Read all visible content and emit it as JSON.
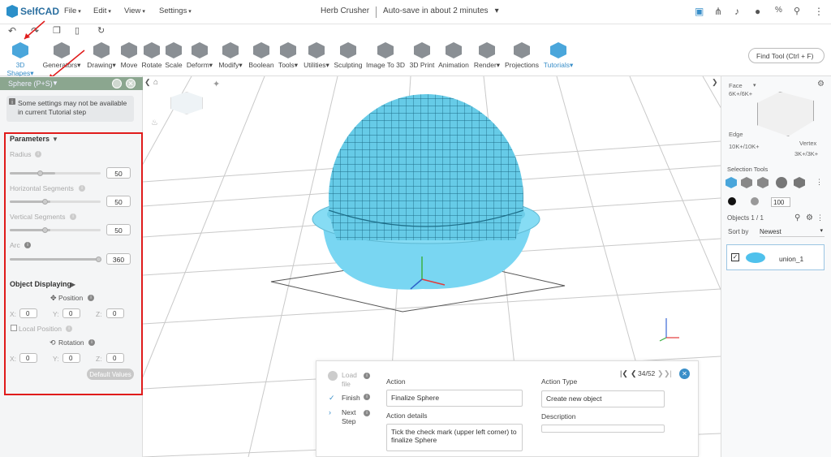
{
  "app": {
    "logo_text": "SelfCAD",
    "doc_name": "Herb Crusher",
    "autosave": "Auto-save in about 2 minutes",
    "autosave_caret": "▾"
  },
  "menus": [
    "File",
    "Edit",
    "View",
    "Settings"
  ],
  "top_icons": [
    "save-icon",
    "share-icon",
    "bell-icon",
    "help-icon",
    "percent-icon",
    "account-icon"
  ],
  "quick": [
    "undo-icon",
    "redo-icon",
    "copy-icon",
    "delete-icon",
    "refresh-icon"
  ],
  "tools": [
    {
      "label": "3D Shapes▾",
      "active": true
    },
    {
      "label": "Generators▾"
    },
    {
      "label": "Drawing▾"
    },
    {
      "label": "Move"
    },
    {
      "label": "Rotate"
    },
    {
      "label": "Scale"
    },
    {
      "label": "Deform▾"
    },
    {
      "label": "Modify▾"
    },
    {
      "label": "Boolean"
    },
    {
      "label": "Tools▾"
    },
    {
      "label": "Utilities▾"
    },
    {
      "label": "Sculpting"
    },
    {
      "label": "Image To 3D"
    },
    {
      "label": "3D Print"
    },
    {
      "label": "Animation"
    },
    {
      "label": "Render▾"
    },
    {
      "label": "Projections"
    },
    {
      "label": "Tutorials▾",
      "active": true
    }
  ],
  "find_tool": "Find Tool (Ctrl + F)",
  "panel": {
    "title": "Sphere (P+S)",
    "notice": "Some settings may not be available in current Tutorial step",
    "parameters": "Parameters",
    "radius": {
      "label": "Radius",
      "value": "50",
      "level": 0.5
    },
    "hseg": {
      "label": "Horizontal Segments",
      "value": "50",
      "level": 0.45
    },
    "vseg": {
      "label": "Vertical Segments",
      "value": "50",
      "level": 0.45
    },
    "arc": {
      "label": "Arc",
      "value": "360",
      "level": 1.0
    },
    "object_displaying": "Object Displaying",
    "position": "Position",
    "x_label": "X:",
    "y_label": "Y:",
    "z_label": "Z:",
    "pos": {
      "x": "0",
      "y": "0",
      "z": "0"
    },
    "local_position": "Local Position",
    "rotation": "Rotation",
    "rot": {
      "x": "0",
      "y": "0",
      "z": "0"
    },
    "default_values": "Default Values"
  },
  "right": {
    "face": "Face",
    "face_count": "6K+/6K+",
    "edge": "Edge",
    "edge_count": "10K+/10K+",
    "vertex": "Vertex",
    "vertex_count": "3K+/3K+",
    "selection_tools": "Selection Tools",
    "opacity": "100",
    "objects_label": "Objects 1 / 1",
    "sort_by": "Sort by",
    "sort_value": "Newest",
    "object_name": "union_1"
  },
  "tutorial": {
    "steps": [
      "Load file",
      "Finish",
      "Next Step"
    ],
    "progress": "34/52",
    "action_label": "Action",
    "action_value": "Finalize Sphere",
    "action_type_label": "Action Type",
    "action_type_value": "Create new object",
    "details_label": "Action details",
    "details_value": "Tick the check mark (upper left corner) to finalize Sphere",
    "description_label": "Description",
    "description_value": ""
  },
  "colors": {
    "accent": "#3a8fc9",
    "mesh": "#6fd0ea",
    "highlight": "#e01b1b"
  }
}
